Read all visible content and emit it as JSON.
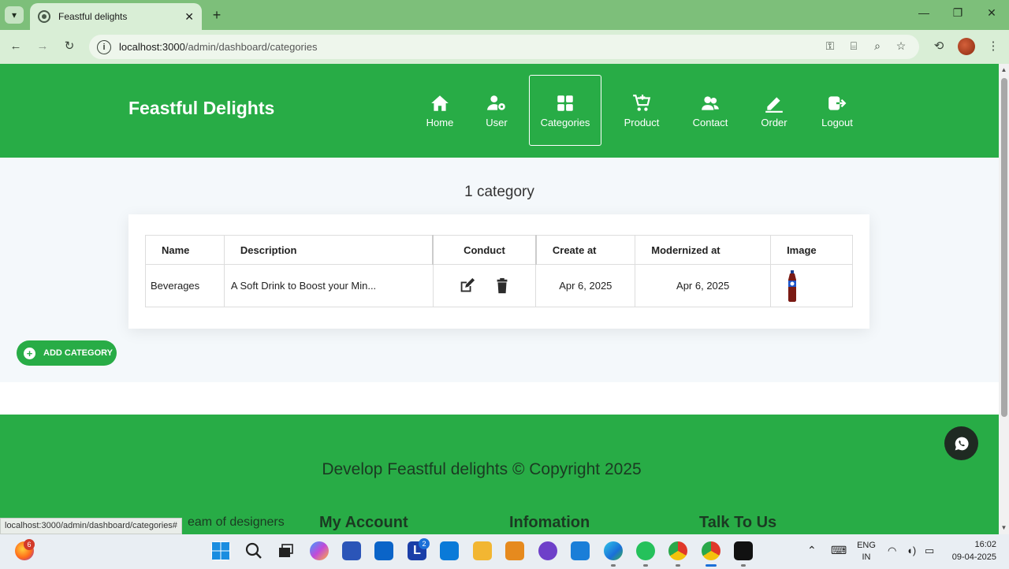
{
  "browser": {
    "tab_title": "Feastful delights",
    "url_host": "localhost:3000",
    "url_path": "/admin/dashboard/categories",
    "status_url": "localhost:3000/admin/dashboard/categories#"
  },
  "header": {
    "brand": "Feastful Delights",
    "nav": [
      {
        "label": "Home",
        "icon": "home-icon"
      },
      {
        "label": "User",
        "icon": "user-gear-icon"
      },
      {
        "label": "Categories",
        "icon": "grid-icon",
        "active": true
      },
      {
        "label": "Product",
        "icon": "cart-icon"
      },
      {
        "label": "Contact",
        "icon": "people-icon"
      },
      {
        "label": "Order",
        "icon": "pen-icon"
      },
      {
        "label": "Logout",
        "icon": "logout-icon"
      }
    ]
  },
  "main": {
    "count_title": "1 category",
    "table": {
      "headers": [
        "Name",
        "Description",
        "Conduct",
        "Create at",
        "Modernized at",
        "Image"
      ],
      "rows": [
        {
          "name": "Beverages",
          "description": "A Soft Drink to Boost your Min...",
          "created": "Apr 6, 2025",
          "modified": "Apr 6, 2025",
          "image": "soft-drink-bottle"
        }
      ]
    },
    "add_button": "ADD CATEGORY"
  },
  "footer": {
    "copyright": "Develop Feastful delights © Copyright 2025",
    "columns": [
      "eam of designers",
      "My Account",
      "Infomation",
      "Talk To Us"
    ]
  },
  "taskbar": {
    "firefox_badge": "6",
    "l_badge": "2",
    "lang_top": "ENG",
    "lang_bottom": "IN",
    "time": "16:02",
    "date": "09-04-2025"
  },
  "colors": {
    "brand_green": "#28ac46",
    "tab_green": "#7dbf7a",
    "toolbar_green": "#d9eed6"
  }
}
